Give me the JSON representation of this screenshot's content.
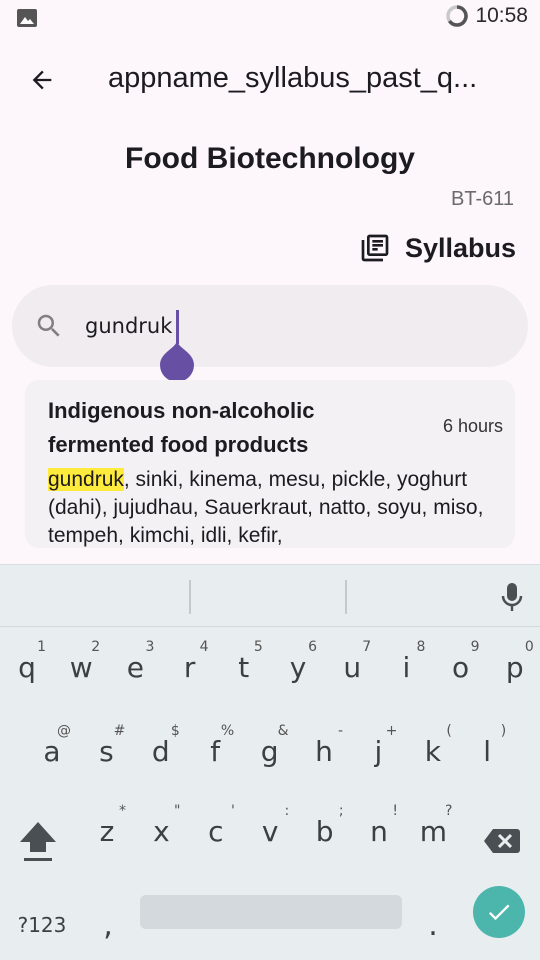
{
  "status_bar": {
    "time": "10:58"
  },
  "app_bar": {
    "title": "appname_syllabus_past_q..."
  },
  "subject": {
    "title": "Food Biotechnology",
    "code": "BT-611"
  },
  "syllabus_button": {
    "label": "Syllabus"
  },
  "search": {
    "value": "gundruk"
  },
  "result": {
    "title": "Indigenous non-alcoholic fermented food products",
    "duration": "6 hours",
    "highlight": "gundruk",
    "body_rest": ", sinki, kinema, mesu, pickle, yoghurt (dahi), jujudhau, Sauerkraut, natto, soyu, miso, tempeh, kimchi, idli, kefir,"
  },
  "keyboard": {
    "row1": [
      {
        "k": "q",
        "h": "1"
      },
      {
        "k": "w",
        "h": "2"
      },
      {
        "k": "e",
        "h": "3"
      },
      {
        "k": "r",
        "h": "4"
      },
      {
        "k": "t",
        "h": "5"
      },
      {
        "k": "y",
        "h": "6"
      },
      {
        "k": "u",
        "h": "7"
      },
      {
        "k": "i",
        "h": "8"
      },
      {
        "k": "o",
        "h": "9"
      },
      {
        "k": "p",
        "h": "0"
      }
    ],
    "row2": [
      {
        "k": "a",
        "h": "@"
      },
      {
        "k": "s",
        "h": "#"
      },
      {
        "k": "d",
        "h": "$"
      },
      {
        "k": "f",
        "h": "%"
      },
      {
        "k": "g",
        "h": "&"
      },
      {
        "k": "h",
        "h": "-"
      },
      {
        "k": "j",
        "h": "+"
      },
      {
        "k": "k",
        "h": "("
      },
      {
        "k": "l",
        "h": ")"
      }
    ],
    "row3": [
      {
        "k": "z",
        "h": "*"
      },
      {
        "k": "x",
        "h": "\""
      },
      {
        "k": "c",
        "h": "'"
      },
      {
        "k": "v",
        "h": ":"
      },
      {
        "k": "b",
        "h": ";"
      },
      {
        "k": "n",
        "h": "!"
      },
      {
        "k": "m",
        "h": "?"
      }
    ],
    "symbols_label": "?123",
    "comma": ",",
    "period": ".",
    "enter_color": "#4db6ac"
  },
  "colors": {
    "accent": "#6750a4",
    "highlight": "#ffeb3b",
    "background": "#fdf6fb"
  }
}
